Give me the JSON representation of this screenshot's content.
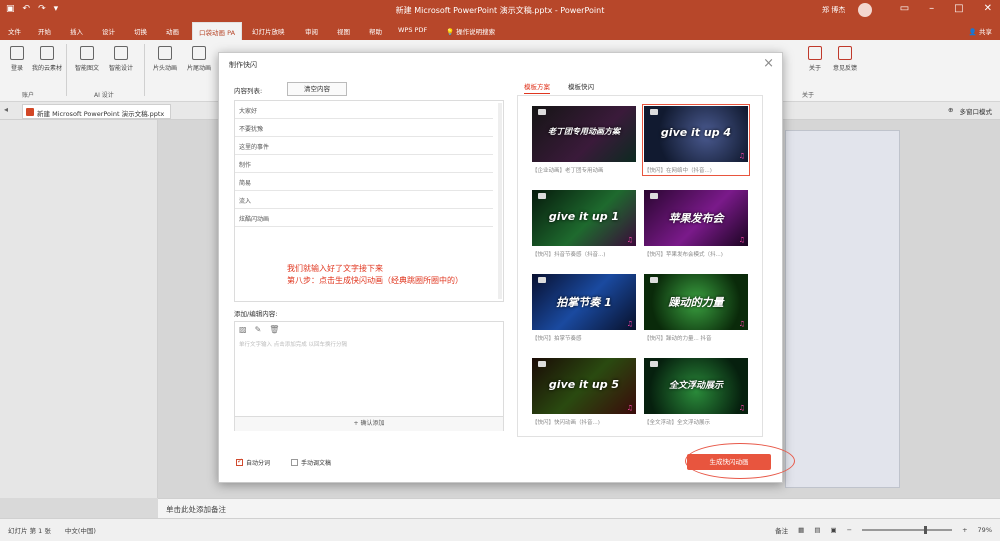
{
  "titlebar": {
    "title": "新建 Microsoft PowerPoint 演示文稿.pptx  -  PowerPoint",
    "user": "郑 博杰"
  },
  "tabs": [
    {
      "label": "文件",
      "active": false
    },
    {
      "label": "开始",
      "active": false
    },
    {
      "label": "插入",
      "active": false
    },
    {
      "label": "设计",
      "active": false
    },
    {
      "label": "切换",
      "active": false
    },
    {
      "label": "动画",
      "active": false
    },
    {
      "label": "口袋动画 PA",
      "active": true
    },
    {
      "label": "幻灯片放映",
      "active": false
    },
    {
      "label": "审阅",
      "active": false
    },
    {
      "label": "视图",
      "active": false
    },
    {
      "label": "帮助",
      "active": false
    },
    {
      "label": "WPS PDF",
      "active": false
    },
    {
      "label": "操作说明搜索",
      "active": false
    }
  ],
  "share_label": "共享",
  "ribbon": {
    "buttons": [
      "登录",
      "我的云素材",
      "智能图文",
      "智能设计",
      "片头动画",
      "片尾动画",
      "关于",
      "意见反馈"
    ],
    "groups": [
      "账户",
      "AI 设计",
      "关于"
    ]
  },
  "doctab": {
    "name": "新建 Microsoft PowerPoint 演示文稿.pptx",
    "right_label": "多窗口模式"
  },
  "dialog": {
    "title": "制作快闪",
    "content_label": "内容列表:",
    "clear_label": "清空内容",
    "items": [
      "大家好",
      "不要犹豫",
      "这里的事件",
      "制作",
      "简易",
      "流入",
      "炫酷闪动画"
    ],
    "annotation_line1": "我们就输入好了文字接下来",
    "annotation_line2": "第八步：点击生成快闪动画（经典跳圈所圈中的）",
    "edit_label": "添加/编辑内容:",
    "edit_placeholder": "单行文字输入 点击添加完成 以回车换行分隔",
    "confirm_add_label": "+ 确认添加",
    "auto_split_label": "自动分词",
    "manual_label": "手动调文稿",
    "generate_label": "生成快闪动画",
    "tpl_tabs": [
      "模板方案",
      "模板快闪"
    ],
    "templates": [
      {
        "text": "老丁团专用动画方案",
        "caption": "【企业动画】老丁团专用动画",
        "bg": "#121212",
        "selected": false
      },
      {
        "text": "give it up 4",
        "caption": "【快闪】在网络中（抖音...)",
        "bg": "#101828",
        "selected": true
      },
      {
        "text": "give it up 1",
        "caption": "【快闪】抖音节奏感（抖音...)",
        "bg": "#0b2a14",
        "selected": false
      },
      {
        "text": "苹果发布会",
        "caption": "【快闪】苹果发布会模式（抖...)",
        "bg": "#2a0a28",
        "selected": false
      },
      {
        "text": "拍掌节奏 1",
        "caption": "【快闪】拍掌节奏感",
        "bg": "#0d1638",
        "selected": false
      },
      {
        "text": "躁动的力量",
        "caption": "【快闪】躁动的力量... 抖音",
        "bg": "#0c2a0c",
        "selected": false
      },
      {
        "text": "give it up 5",
        "caption": "【快闪】快闪动画（抖音...)",
        "bg": "#1a1a10",
        "selected": false
      },
      {
        "text": "全文浮动展示",
        "caption": "【全文浮动】全文浮动展示",
        "bg": "#0c2418",
        "selected": false
      }
    ]
  },
  "notes": "单击此处添加备注",
  "status": {
    "slide_indicator": "幻灯片 第 1 张",
    "language": "中文(中国)",
    "notes_btn": "备注",
    "zoom": "79%"
  }
}
